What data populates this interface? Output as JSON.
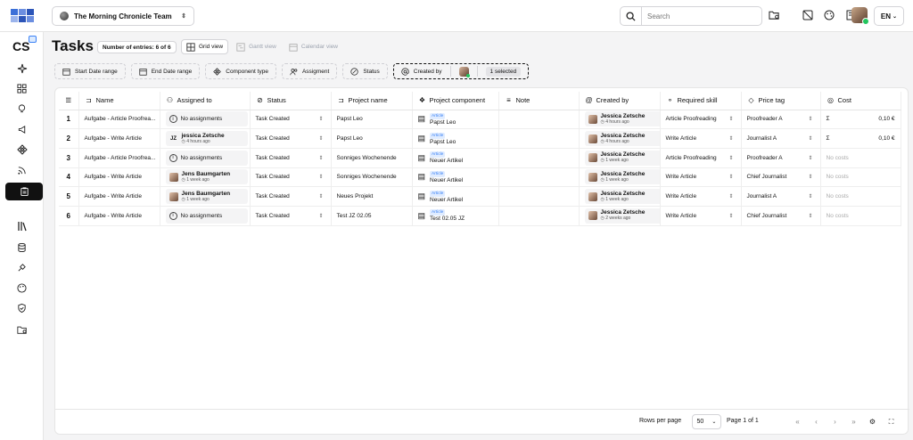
{
  "topbar": {
    "team_name": "The Morning Chronicle Team",
    "search_placeholder": "Search",
    "language": "EN"
  },
  "sidebar": {
    "brand": "CS"
  },
  "page": {
    "title": "Tasks",
    "entries_badge": "Number of entries: 6 of 6",
    "views": [
      "Grid view",
      "Gantt view",
      "Calendar view"
    ]
  },
  "filters": {
    "start_date": "Start Date range",
    "end_date": "End Date range",
    "component_type": "Component type",
    "assignment": "Assigment",
    "status": "Status",
    "created_by": "Created by",
    "created_by_selected": "1 selected"
  },
  "table": {
    "headers": [
      "Name",
      "Assigned to",
      "Status",
      "Project name",
      "Project component",
      "Note",
      "Created by",
      "Required skill",
      "Price tag",
      "Cost"
    ],
    "rows": [
      {
        "idx": "1",
        "name": "Aufgabe - Article Proofrea...",
        "assigned_name": "No assignments",
        "assigned_time": "",
        "status": "Task Created",
        "project": "Papst Leo",
        "comp_tag": "Article",
        "comp_name": "Papst Leo",
        "creator": "Jessica Zetsche",
        "creator_time": "4 hours ago",
        "skill": "Article Proofreading",
        "price": "Proofreader A",
        "cost_sym": "Σ",
        "cost": "0,10 €"
      },
      {
        "idx": "2",
        "name": "Aufgabe - Write Article",
        "assigned_name": "jessica Zetsche",
        "assigned_time": "4 hours ago",
        "status": "Task Created",
        "project": "Papst Leo",
        "comp_tag": "Article",
        "comp_name": "Papst Leo",
        "creator": "Jessica Zetsche",
        "creator_time": "4 hours ago",
        "skill": "Write Article",
        "price": "Journalist A",
        "cost_sym": "Σ",
        "cost": "0,10 €"
      },
      {
        "idx": "3",
        "name": "Aufgabe - Article Proofrea...",
        "assigned_name": "No assignments",
        "assigned_time": "",
        "status": "Task Created",
        "project": "Sonniges Wochenende",
        "comp_tag": "Article",
        "comp_name": "Neuer Artikel",
        "creator": "Jessica Zetsche",
        "creator_time": "1 week ago",
        "skill": "Article Proofreading",
        "price": "Proofreader A",
        "cost_sym": "",
        "cost": "No costs"
      },
      {
        "idx": "4",
        "name": "Aufgabe - Write Article",
        "assigned_name": "Jens Baumgarten",
        "assigned_time": "1 week ago",
        "status": "Task Created",
        "project": "Sonniges Wochenende",
        "comp_tag": "Article",
        "comp_name": "Neuer Artikel",
        "creator": "Jessica Zetsche",
        "creator_time": "1 week ago",
        "skill": "Write Article",
        "price": "Chief Journalist",
        "cost_sym": "",
        "cost": "No costs"
      },
      {
        "idx": "5",
        "name": "Aufgabe - Write Article",
        "assigned_name": "Jens Baumgarten",
        "assigned_time": "1 week ago",
        "status": "Task Created",
        "project": "Neues Projekt",
        "comp_tag": "Article",
        "comp_name": "Neuer Artikel",
        "creator": "Jessica Zetsche",
        "creator_time": "1 week ago",
        "skill": "Write Article",
        "price": "Journalist A",
        "cost_sym": "",
        "cost": "No costs"
      },
      {
        "idx": "6",
        "name": "Aufgabe - Write Article",
        "assigned_name": "No assignments",
        "assigned_time": "",
        "status": "Task Created",
        "project": "Test JZ 02.05",
        "comp_tag": "Article",
        "comp_name": "Test 02.05 JZ",
        "creator": "Jessica Zetsche",
        "creator_time": "2 weeks ago",
        "skill": "Write Article",
        "price": "Chief Journalist",
        "cost_sym": "",
        "cost": "No costs"
      }
    ]
  },
  "pager": {
    "rows_per_page_label": "Rows per page",
    "rows_per_page": "50",
    "page_label": "Page 1 of 1"
  },
  "colors": {
    "accent": "#3b82f6",
    "online": "#22c55e",
    "active_nav": "#111111"
  }
}
